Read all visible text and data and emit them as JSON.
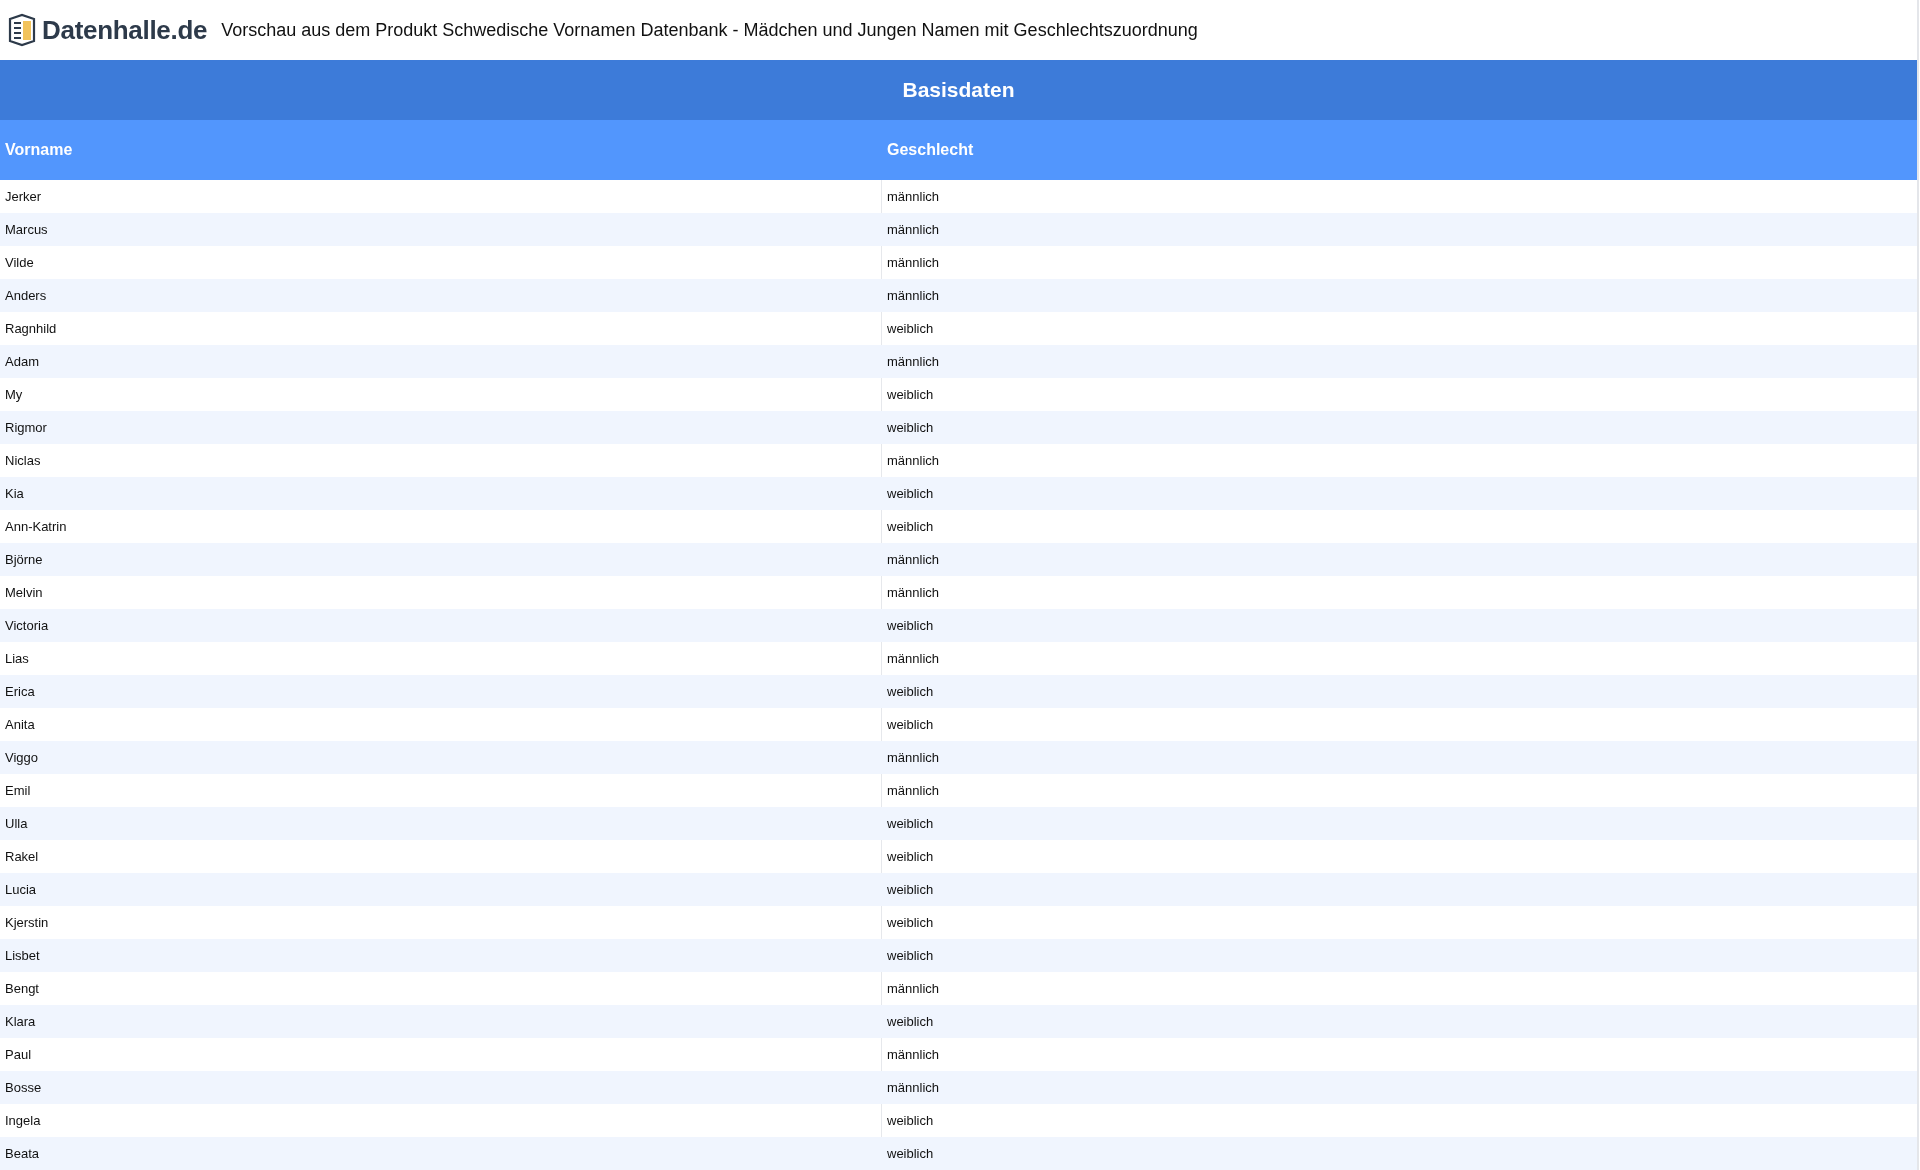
{
  "header": {
    "logo_text": "Datenhalle.de",
    "title": "Vorschau aus dem Produkt Schwedische Vornamen Datenbank - Mädchen und Jungen Namen mit Geschlechtszuordnung"
  },
  "table": {
    "group_title": "Basisdaten",
    "columns": [
      "Vorname",
      "Geschlecht"
    ],
    "rows": [
      [
        "Jerker",
        "männlich"
      ],
      [
        "Marcus",
        "männlich"
      ],
      [
        "Vilde",
        "männlich"
      ],
      [
        "Anders",
        "männlich"
      ],
      [
        "Ragnhild",
        "weiblich"
      ],
      [
        "Adam",
        "männlich"
      ],
      [
        "My",
        "weiblich"
      ],
      [
        "Rigmor",
        "weiblich"
      ],
      [
        "Niclas",
        "männlich"
      ],
      [
        "Kia",
        "weiblich"
      ],
      [
        "Ann-Katrin",
        "weiblich"
      ],
      [
        "Björne",
        "männlich"
      ],
      [
        "Melvin",
        "männlich"
      ],
      [
        "Victoria",
        "weiblich"
      ],
      [
        "Lias",
        "männlich"
      ],
      [
        "Erica",
        "weiblich"
      ],
      [
        "Anita",
        "weiblich"
      ],
      [
        "Viggo",
        "männlich"
      ],
      [
        "Emil",
        "männlich"
      ],
      [
        "Ulla",
        "weiblich"
      ],
      [
        "Rakel",
        "weiblich"
      ],
      [
        "Lucia",
        "weiblich"
      ],
      [
        "Kjerstin",
        "weiblich"
      ],
      [
        "Lisbet",
        "weiblich"
      ],
      [
        "Bengt",
        "männlich"
      ],
      [
        "Klara",
        "weiblich"
      ],
      [
        "Paul",
        "männlich"
      ],
      [
        "Bosse",
        "männlich"
      ],
      [
        "Ingela",
        "weiblich"
      ],
      [
        "Beata",
        "weiblich"
      ]
    ]
  }
}
